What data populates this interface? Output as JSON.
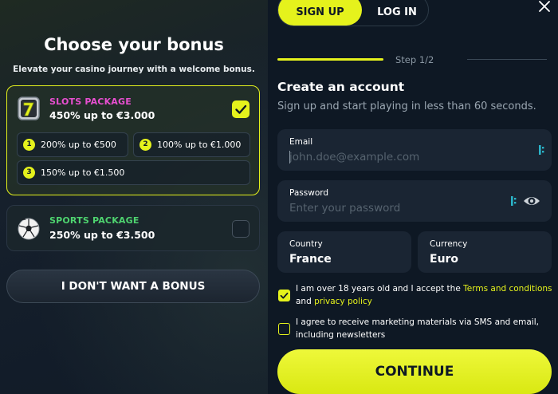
{
  "left": {
    "title": "Choose your bonus",
    "subtitle": "Elevate your casino journey with a welcome bonus.",
    "slots": {
      "name": "SLOTS PACKAGE",
      "amount": "450% up to €3.000",
      "name_color": "#e84fd1",
      "options": [
        {
          "num": "1",
          "text": "200% up to €500"
        },
        {
          "num": "2",
          "text": "100% up to €1.000"
        },
        {
          "num": "3",
          "text": "150% up to €1.500"
        }
      ]
    },
    "sports": {
      "name": "SPORTS PACKAGE",
      "amount": "250% up to €3.500",
      "name_color": "#4ed36f"
    },
    "no_bonus": "I DON'T WANT A BONUS"
  },
  "right": {
    "tabs": {
      "signup": "SIGN UP",
      "login": "LOG IN"
    },
    "step": "Step 1/2",
    "heading": "Create an account",
    "description": "Sign up and start playing in less than 60 seconds.",
    "email": {
      "label": "Email",
      "placeholder": "john.doe@example.com"
    },
    "password": {
      "label": "Password",
      "placeholder": "Enter your password"
    },
    "country": {
      "label": "Country",
      "value": "France"
    },
    "currency": {
      "label": "Currency",
      "value": "Euro"
    },
    "age_terms": {
      "prefix": "I am over 18 years old and I accept the ",
      "terms": "Terms and conditions",
      "and": " and ",
      "privacy": "privacy policy",
      "checked": true
    },
    "marketing": {
      "text": "I agree to receive marketing materials via SMS and email, including newsletters",
      "checked": false
    },
    "continue": "CONTINUE"
  },
  "colors": {
    "accent": "#e5f21c",
    "background": "#0e1824",
    "field": "#1a2533"
  },
  "icons": [
    "seven-slot-icon",
    "soccer-ball-icon",
    "check-icon",
    "close-icon",
    "password-manager-icon",
    "eye-icon"
  ]
}
